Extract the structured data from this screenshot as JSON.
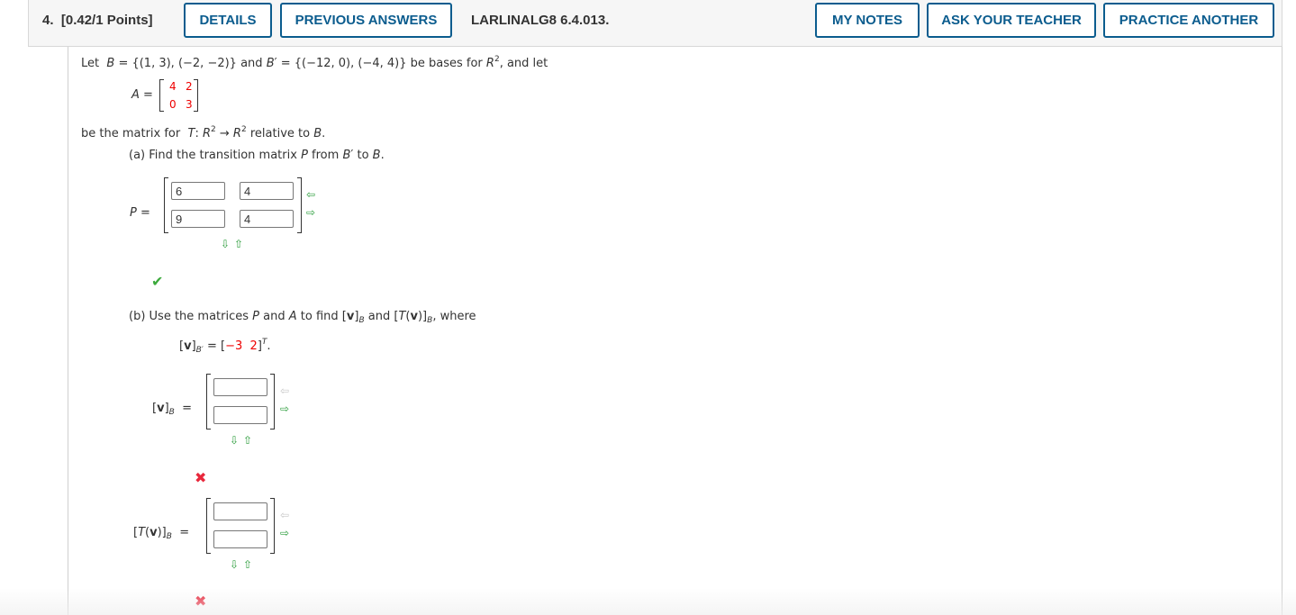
{
  "header": {
    "question_number": "4.",
    "points": "[0.42/1 Points]",
    "details_label": "DETAILS",
    "previous_answers_label": "PREVIOUS ANSWERS",
    "question_id": "LARLINALG8 6.4.013.",
    "my_notes_label": "MY NOTES",
    "ask_teacher_label": "ASK YOUR TEACHER",
    "practice_another_label": "PRACTICE ANOTHER"
  },
  "problem": {
    "intro_let": "Let",
    "B_def": "= {(1, 3), (−2, −2)} and",
    "Bp_def": "= {(−12, 0), (−4, 4)} be bases for",
    "and_let": ", and let",
    "matrix_A": [
      [
        "4",
        "2"
      ],
      [
        "0",
        "3"
      ]
    ],
    "matrix_for_text": "be the matrix for",
    "relative_to": "relative to",
    "part_a": {
      "label": "(a) Find the transition matrix",
      "from": "from",
      "to": "to",
      "answers": [
        [
          "6",
          "4"
        ],
        [
          "9",
          "4"
        ]
      ],
      "status": "correct"
    },
    "part_b": {
      "label": "(b) Use the matrices",
      "and_word": "and",
      "to_find": "to find",
      "where": ", where",
      "vBp_values": [
        "−3",
        "2"
      ],
      "vB_answers": [
        "",
        ""
      ],
      "TvB_answers": [
        "",
        ""
      ],
      "vB_status": "incorrect",
      "TvB_status": "incorrect"
    }
  },
  "icons": {
    "left_arrow": "⇦",
    "right_arrow": "⇨",
    "down_arrow": "⇩",
    "up_arrow": "⇧",
    "check": "✔",
    "x": "✖"
  }
}
